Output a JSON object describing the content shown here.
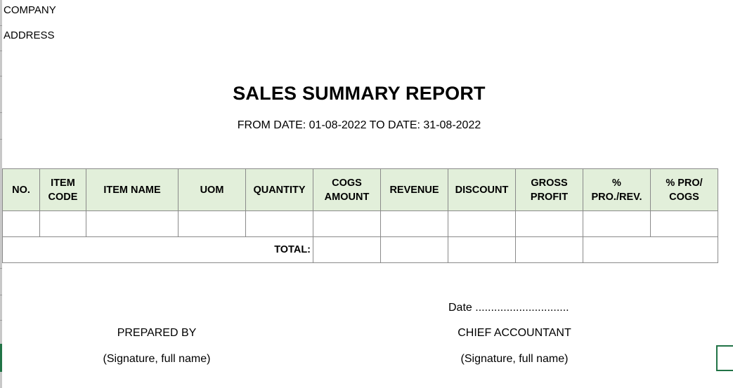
{
  "header": {
    "company": "COMPANY",
    "address": "ADDRESS",
    "title": "SALES SUMMARY REPORT",
    "date_range": "FROM DATE: 01-08-2022 TO DATE: 31-08-2022"
  },
  "table": {
    "columns": [
      "NO.",
      "ITEM\nCODE",
      "ITEM NAME",
      "UOM",
      "QUANTITY",
      "COGS\nAMOUNT",
      "REVENUE",
      "DISCOUNT",
      "GROSS\nPROFIT",
      "%\nPRO./REV.",
      "% PRO/\nCOGS"
    ],
    "total_label": "TOTAL:"
  },
  "footer": {
    "date_line": "Date ..............................",
    "prepared_by": "PREPARED BY",
    "prepared_sig": "(Signature, full name)",
    "chief_accountant": "CHIEF ACCOUNTANT",
    "chief_sig": "(Signature, full name)"
  }
}
